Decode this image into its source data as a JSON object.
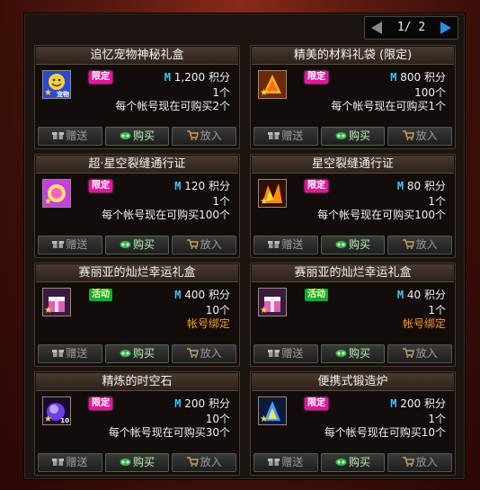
{
  "pager": {
    "page_text": "1/ 2"
  },
  "cards": [
    {
      "title": "追忆宠物神秘礼盒",
      "badge": "限定",
      "badge_color": "pink",
      "icon": "pet-smiley-icon",
      "icon_tag": "宠物",
      "price_value": "1,200",
      "price_unit": "积分",
      "quantity": "1个",
      "limit": "每个帐号现在可购买2个",
      "limit_color": "white",
      "actions": [
        "赠送",
        "购买",
        "放入"
      ]
    },
    {
      "title": "精美的材料礼袋 (限定)",
      "badge": "限定",
      "badge_color": "pink",
      "icon": "material-bag-icon",
      "icon_tag": "",
      "price_value": "800",
      "price_unit": "积分",
      "quantity": "100个",
      "limit": "每个帐号现在可购买1个",
      "limit_color": "white",
      "actions": [
        "赠送",
        "购买",
        "放入"
      ]
    },
    {
      "title": "超·星空裂缝通行证",
      "badge": "限定",
      "badge_color": "pink",
      "icon": "starry-rift-pass-icon",
      "icon_tag": "",
      "price_value": "120",
      "price_unit": "积分",
      "quantity": "1个",
      "limit": "每个帐号现在可购买100个",
      "limit_color": "white",
      "actions": [
        "赠送",
        "购买",
        "放入"
      ]
    },
    {
      "title": "星空裂缝通行证",
      "badge": "限定",
      "badge_color": "pink",
      "icon": "rift-pass-icon",
      "icon_tag": "",
      "price_value": "80",
      "price_unit": "积分",
      "quantity": "1个",
      "limit": "每个帐号现在可购买100个",
      "limit_color": "white",
      "actions": [
        "赠送",
        "购买",
        "放入"
      ]
    },
    {
      "title": "赛丽亚的灿烂幸运礼盒",
      "badge": "活动",
      "badge_color": "green",
      "icon": "lucky-gift-box-icon",
      "icon_tag": "",
      "price_value": "400",
      "price_unit": "积分",
      "quantity": "10个",
      "limit": "帐号绑定",
      "limit_color": "orange",
      "actions": [
        "赠送",
        "购买",
        "放入"
      ]
    },
    {
      "title": "赛丽亚的灿烂幸运礼盒",
      "badge": "活动",
      "badge_color": "green",
      "icon": "lucky-gift-box-icon",
      "icon_tag": "",
      "price_value": "40",
      "price_unit": "积分",
      "quantity": "1个",
      "limit": "帐号绑定",
      "limit_color": "orange",
      "actions": [
        "赠送",
        "购买",
        "放入"
      ]
    },
    {
      "title": "精炼的时空石",
      "badge": "限定",
      "badge_color": "pink",
      "icon": "spacetime-stone-icon",
      "icon_tag": "10",
      "price_value": "200",
      "price_unit": "积分",
      "quantity": "10个",
      "limit": "每个帐号现在可购买30个",
      "limit_color": "white",
      "actions": [
        "赠送",
        "购买",
        "放入"
      ]
    },
    {
      "title": "便携式锻造炉",
      "badge": "限定",
      "badge_color": "pink",
      "icon": "portable-forge-icon",
      "icon_tag": "",
      "price_value": "200",
      "price_unit": "积分",
      "quantity": "1个",
      "limit": "每个帐号现在可购买10个",
      "limit_color": "white",
      "actions": [
        "赠送",
        "购买",
        "放入"
      ]
    }
  ]
}
